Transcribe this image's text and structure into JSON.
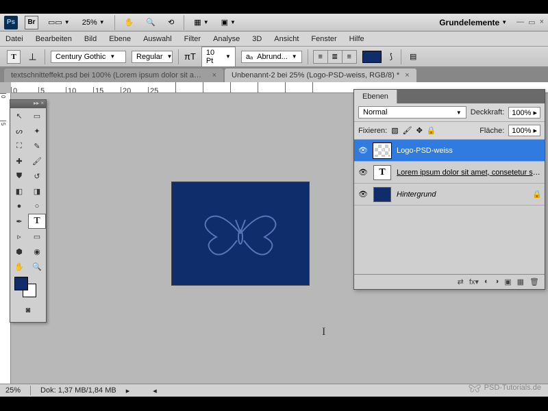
{
  "topbar": {
    "zoom": "25%",
    "workspace_label": "Grundelemente"
  },
  "menu": {
    "items": [
      "Datei",
      "Bearbeiten",
      "Bild",
      "Ebene",
      "Auswahl",
      "Filter",
      "Analyse",
      "3D",
      "Ansicht",
      "Fenster",
      "Hilfe"
    ]
  },
  "options": {
    "font_family": "Century Gothic",
    "font_style": "Regular",
    "font_size": "10 Pt",
    "aa_label": "aₐ",
    "aa_value": "Abrund...",
    "text_color": "#0f2d6b"
  },
  "tabs": [
    {
      "label": "textschnitteffekt.psd bei 100% (Lorem ipsum dolor sit amet, c...",
      "active": false
    },
    {
      "label": "Unbenannt-2 bei 25% (Logo-PSD-weiss, RGB/8) *",
      "active": true
    }
  ],
  "layers_panel": {
    "title": "Ebenen",
    "blend_mode": "Normal",
    "opacity_label": "Deckkraft:",
    "opacity_value": "100%",
    "lock_label": "Fixieren:",
    "fill_label": "Fläche:",
    "fill_value": "100%",
    "layers": [
      {
        "name": "Logo-PSD-weiss",
        "selected": true,
        "type": "smart"
      },
      {
        "name": "Lorem ipsum dolor sit amet, consetetur sadips...",
        "selected": false,
        "type": "text"
      },
      {
        "name": "Hintergrund",
        "selected": false,
        "type": "bg",
        "locked": true
      }
    ]
  },
  "status": {
    "zoom": "25%",
    "doc_info": "Dok: 1,37 MB/1,84 MB"
  },
  "watermark": "PSD-Tutorials.de",
  "ruler_marks": [
    "0",
    "5",
    "10",
    "15",
    "20",
    "25"
  ],
  "canvas_color": "#0f2d6b"
}
